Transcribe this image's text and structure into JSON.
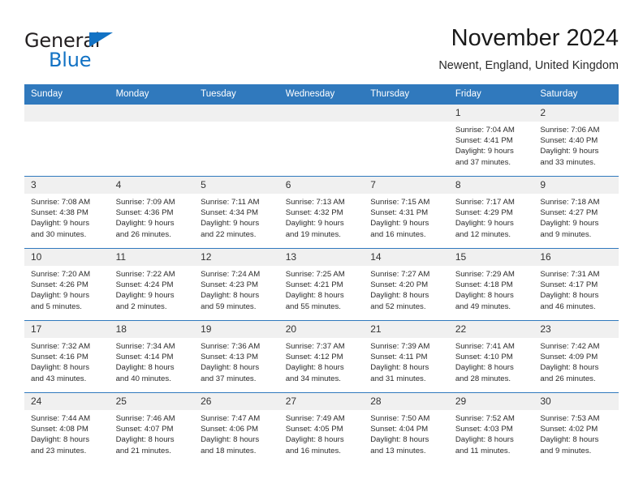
{
  "brand": {
    "name_top": "General",
    "name_bottom": "Blue",
    "accent_color": "#1272c4"
  },
  "header": {
    "month_title": "November 2024",
    "location": "Newent, England, United Kingdom"
  },
  "calendar": {
    "header_bg_color": "#3079bd",
    "daynum_bg_color": "#f0f0f0",
    "weekday_headers": [
      "Sunday",
      "Monday",
      "Tuesday",
      "Wednesday",
      "Thursday",
      "Friday",
      "Saturday"
    ],
    "weeks": [
      [
        {
          "day": "",
          "empty": true
        },
        {
          "day": "",
          "empty": true
        },
        {
          "day": "",
          "empty": true
        },
        {
          "day": "",
          "empty": true
        },
        {
          "day": "",
          "empty": true
        },
        {
          "day": "1",
          "sunrise": "Sunrise: 7:04 AM",
          "sunset": "Sunset: 4:41 PM",
          "daylight_1": "Daylight: 9 hours",
          "daylight_2": "and 37 minutes."
        },
        {
          "day": "2",
          "sunrise": "Sunrise: 7:06 AM",
          "sunset": "Sunset: 4:40 PM",
          "daylight_1": "Daylight: 9 hours",
          "daylight_2": "and 33 minutes."
        }
      ],
      [
        {
          "day": "3",
          "sunrise": "Sunrise: 7:08 AM",
          "sunset": "Sunset: 4:38 PM",
          "daylight_1": "Daylight: 9 hours",
          "daylight_2": "and 30 minutes."
        },
        {
          "day": "4",
          "sunrise": "Sunrise: 7:09 AM",
          "sunset": "Sunset: 4:36 PM",
          "daylight_1": "Daylight: 9 hours",
          "daylight_2": "and 26 minutes."
        },
        {
          "day": "5",
          "sunrise": "Sunrise: 7:11 AM",
          "sunset": "Sunset: 4:34 PM",
          "daylight_1": "Daylight: 9 hours",
          "daylight_2": "and 22 minutes."
        },
        {
          "day": "6",
          "sunrise": "Sunrise: 7:13 AM",
          "sunset": "Sunset: 4:32 PM",
          "daylight_1": "Daylight: 9 hours",
          "daylight_2": "and 19 minutes."
        },
        {
          "day": "7",
          "sunrise": "Sunrise: 7:15 AM",
          "sunset": "Sunset: 4:31 PM",
          "daylight_1": "Daylight: 9 hours",
          "daylight_2": "and 16 minutes."
        },
        {
          "day": "8",
          "sunrise": "Sunrise: 7:17 AM",
          "sunset": "Sunset: 4:29 PM",
          "daylight_1": "Daylight: 9 hours",
          "daylight_2": "and 12 minutes."
        },
        {
          "day": "9",
          "sunrise": "Sunrise: 7:18 AM",
          "sunset": "Sunset: 4:27 PM",
          "daylight_1": "Daylight: 9 hours",
          "daylight_2": "and 9 minutes."
        }
      ],
      [
        {
          "day": "10",
          "sunrise": "Sunrise: 7:20 AM",
          "sunset": "Sunset: 4:26 PM",
          "daylight_1": "Daylight: 9 hours",
          "daylight_2": "and 5 minutes."
        },
        {
          "day": "11",
          "sunrise": "Sunrise: 7:22 AM",
          "sunset": "Sunset: 4:24 PM",
          "daylight_1": "Daylight: 9 hours",
          "daylight_2": "and 2 minutes."
        },
        {
          "day": "12",
          "sunrise": "Sunrise: 7:24 AM",
          "sunset": "Sunset: 4:23 PM",
          "daylight_1": "Daylight: 8 hours",
          "daylight_2": "and 59 minutes."
        },
        {
          "day": "13",
          "sunrise": "Sunrise: 7:25 AM",
          "sunset": "Sunset: 4:21 PM",
          "daylight_1": "Daylight: 8 hours",
          "daylight_2": "and 55 minutes."
        },
        {
          "day": "14",
          "sunrise": "Sunrise: 7:27 AM",
          "sunset": "Sunset: 4:20 PM",
          "daylight_1": "Daylight: 8 hours",
          "daylight_2": "and 52 minutes."
        },
        {
          "day": "15",
          "sunrise": "Sunrise: 7:29 AM",
          "sunset": "Sunset: 4:18 PM",
          "daylight_1": "Daylight: 8 hours",
          "daylight_2": "and 49 minutes."
        },
        {
          "day": "16",
          "sunrise": "Sunrise: 7:31 AM",
          "sunset": "Sunset: 4:17 PM",
          "daylight_1": "Daylight: 8 hours",
          "daylight_2": "and 46 minutes."
        }
      ],
      [
        {
          "day": "17",
          "sunrise": "Sunrise: 7:32 AM",
          "sunset": "Sunset: 4:16 PM",
          "daylight_1": "Daylight: 8 hours",
          "daylight_2": "and 43 minutes."
        },
        {
          "day": "18",
          "sunrise": "Sunrise: 7:34 AM",
          "sunset": "Sunset: 4:14 PM",
          "daylight_1": "Daylight: 8 hours",
          "daylight_2": "and 40 minutes."
        },
        {
          "day": "19",
          "sunrise": "Sunrise: 7:36 AM",
          "sunset": "Sunset: 4:13 PM",
          "daylight_1": "Daylight: 8 hours",
          "daylight_2": "and 37 minutes."
        },
        {
          "day": "20",
          "sunrise": "Sunrise: 7:37 AM",
          "sunset": "Sunset: 4:12 PM",
          "daylight_1": "Daylight: 8 hours",
          "daylight_2": "and 34 minutes."
        },
        {
          "day": "21",
          "sunrise": "Sunrise: 7:39 AM",
          "sunset": "Sunset: 4:11 PM",
          "daylight_1": "Daylight: 8 hours",
          "daylight_2": "and 31 minutes."
        },
        {
          "day": "22",
          "sunrise": "Sunrise: 7:41 AM",
          "sunset": "Sunset: 4:10 PM",
          "daylight_1": "Daylight: 8 hours",
          "daylight_2": "and 28 minutes."
        },
        {
          "day": "23",
          "sunrise": "Sunrise: 7:42 AM",
          "sunset": "Sunset: 4:09 PM",
          "daylight_1": "Daylight: 8 hours",
          "daylight_2": "and 26 minutes."
        }
      ],
      [
        {
          "day": "24",
          "sunrise": "Sunrise: 7:44 AM",
          "sunset": "Sunset: 4:08 PM",
          "daylight_1": "Daylight: 8 hours",
          "daylight_2": "and 23 minutes."
        },
        {
          "day": "25",
          "sunrise": "Sunrise: 7:46 AM",
          "sunset": "Sunset: 4:07 PM",
          "daylight_1": "Daylight: 8 hours",
          "daylight_2": "and 21 minutes."
        },
        {
          "day": "26",
          "sunrise": "Sunrise: 7:47 AM",
          "sunset": "Sunset: 4:06 PM",
          "daylight_1": "Daylight: 8 hours",
          "daylight_2": "and 18 minutes."
        },
        {
          "day": "27",
          "sunrise": "Sunrise: 7:49 AM",
          "sunset": "Sunset: 4:05 PM",
          "daylight_1": "Daylight: 8 hours",
          "daylight_2": "and 16 minutes."
        },
        {
          "day": "28",
          "sunrise": "Sunrise: 7:50 AM",
          "sunset": "Sunset: 4:04 PM",
          "daylight_1": "Daylight: 8 hours",
          "daylight_2": "and 13 minutes."
        },
        {
          "day": "29",
          "sunrise": "Sunrise: 7:52 AM",
          "sunset": "Sunset: 4:03 PM",
          "daylight_1": "Daylight: 8 hours",
          "daylight_2": "and 11 minutes."
        },
        {
          "day": "30",
          "sunrise": "Sunrise: 7:53 AM",
          "sunset": "Sunset: 4:02 PM",
          "daylight_1": "Daylight: 8 hours",
          "daylight_2": "and 9 minutes."
        }
      ]
    ]
  }
}
